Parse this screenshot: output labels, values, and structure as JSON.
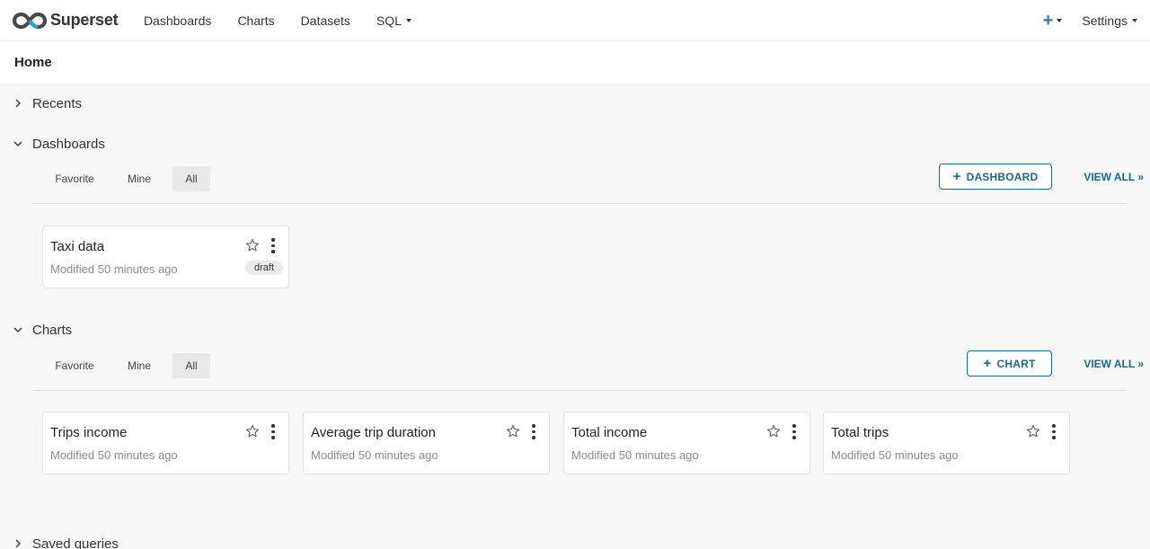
{
  "nav": {
    "brand": "Superset",
    "items": [
      "Dashboards",
      "Charts",
      "Datasets",
      "SQL"
    ],
    "settings": "Settings"
  },
  "page": {
    "title": "Home"
  },
  "sections": {
    "recents": {
      "title": "Recents"
    },
    "dashboards": {
      "title": "Dashboards",
      "tabs": [
        "Favorite",
        "Mine",
        "All"
      ],
      "active_tab": "All",
      "add_label": "DASHBOARD",
      "view_all": "VIEW ALL »",
      "cards": [
        {
          "title": "Taxi data",
          "modified": "Modified 50 minutes ago",
          "badge": "draft"
        }
      ]
    },
    "charts": {
      "title": "Charts",
      "tabs": [
        "Favorite",
        "Mine",
        "All"
      ],
      "active_tab": "All",
      "add_label": "CHART",
      "view_all": "VIEW ALL »",
      "cards": [
        {
          "title": "Trips income",
          "modified": "Modified 50 minutes ago"
        },
        {
          "title": "Average trip duration",
          "modified": "Modified 50 minutes ago"
        },
        {
          "title": "Total income",
          "modified": "Modified 50 minutes ago"
        },
        {
          "title": "Total trips",
          "modified": "Modified 50 minutes ago"
        }
      ]
    },
    "saved_queries": {
      "title": "Saved queries"
    }
  },
  "colors": {
    "accent": "#1a85a0",
    "button_border": "#1a6a80"
  }
}
